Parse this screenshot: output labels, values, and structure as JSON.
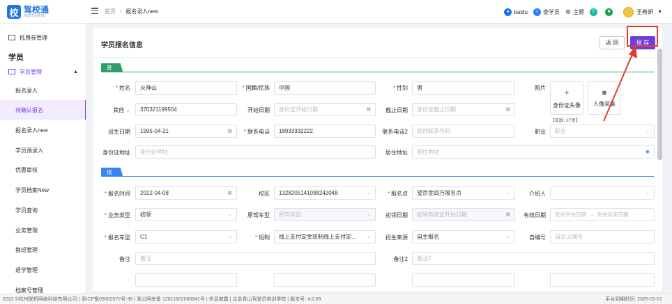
{
  "header": {
    "logo_mark": "校",
    "logo_name": "驾校通",
    "logo_sub": "驾驶培训管理",
    "breadcrumb": [
      "首页",
      "报名录入new"
    ],
    "right_items": [
      {
        "icon": "baidu-icon",
        "label": "baidu",
        "color": "#1a73e8"
      },
      {
        "icon": "search-student-icon",
        "label": "查学员",
        "color": "#2b7cff"
      },
      {
        "icon": "theme-icon",
        "label": "主题",
        "color": "#555"
      },
      {
        "icon": "refresh-icon",
        "label": "",
        "color": "#14b8a6"
      },
      {
        "icon": "status-icon",
        "label": "",
        "color": "#16a34a"
      }
    ],
    "user_name": "王希妍"
  },
  "sidebar": {
    "top_item": "抵用券管理",
    "group_title": "学员",
    "parent_item": "学员管理",
    "items": [
      "报名录入",
      "待确认报名",
      "报名录入new",
      "学员预录入",
      "优惠审核",
      "学员档案New",
      "学员查询",
      "业务管理",
      "换班管理",
      "退学管理",
      "档案号管理"
    ],
    "active_index": 1
  },
  "card": {
    "title": "学员报名信息",
    "back_label": "返 回",
    "save_label": "保 存"
  },
  "sections": {
    "basic": "基础信息",
    "signup": "报名信息"
  },
  "form": {
    "name_label": "姓名",
    "name_value": "火神山",
    "nationality_label": "国籍/民族",
    "nationality_value": "中国",
    "gender_label": "性别",
    "gender_value": "男",
    "photo_label": "照片",
    "id_photo_label": "身份证头像",
    "face_photo_label": "人像采集",
    "age_text": "【年龄: 27岁】",
    "other_label": "其他",
    "other_value": "370321199504",
    "start_date_label": "开始日期",
    "start_date_ph": "身份证开始日期",
    "end_date_label": "截止日期",
    "end_date_ph": "身份证截止日期",
    "birth_label": "出生日期",
    "birth_value": "1995-04-21",
    "phone_label": "联系电话",
    "phone_value": "18933332222",
    "phone2_label": "联系电话2",
    "phone2_ph": "其他联系号码",
    "job_label": "职业",
    "job_ph": "职业",
    "id_addr_label": "身份证地址",
    "id_addr_ph": "身份证地址",
    "live_addr_label": "居住地址",
    "live_addr_ph": "居住地址",
    "signup_time_label": "报名时间",
    "signup_time_value": "2022-04-08",
    "campus_label": "校区",
    "campus_value": "1328205141098242048",
    "signup_point_label": "报名点",
    "signup_point_value": "望京金四万报名点",
    "introducer_label": "介绍人",
    "biz_type_label": "业务类型",
    "biz_type_value": "初领",
    "orig_car_label": "原驾车型",
    "orig_car_ph": "原驾车型",
    "first_date_label": "初领日期",
    "first_date_ph": "初领驾驶证开始日期",
    "valid_date_label": "有效日期",
    "valid_start_ph": "有效开始日期",
    "valid_end_ph": "有效结束日期",
    "car_type_label": "报名车型",
    "car_type_value": "C1",
    "class_label": "班制",
    "class_value": "线上支付定金班制线上支付定…",
    "source_label": "招生来源",
    "source_value": "自主报名",
    "custom_no_label": "自编号",
    "custom_no_ph": "自定义编号",
    "remark_label": "备注",
    "remark_ph": "备注",
    "remark2_label": "备注2",
    "remark2_ph": "备注2"
  },
  "footer": {
    "left": "2022 ©杭州联桥网络科技有限公司 | 浙ICP备09002072号-38 | 浙公网安备 12011602000841号 | 信息披露 | 北京青山驾驶员培训学校 | 版本号: 4.0.69",
    "right": "平台到期时间: 2025-01-01"
  }
}
